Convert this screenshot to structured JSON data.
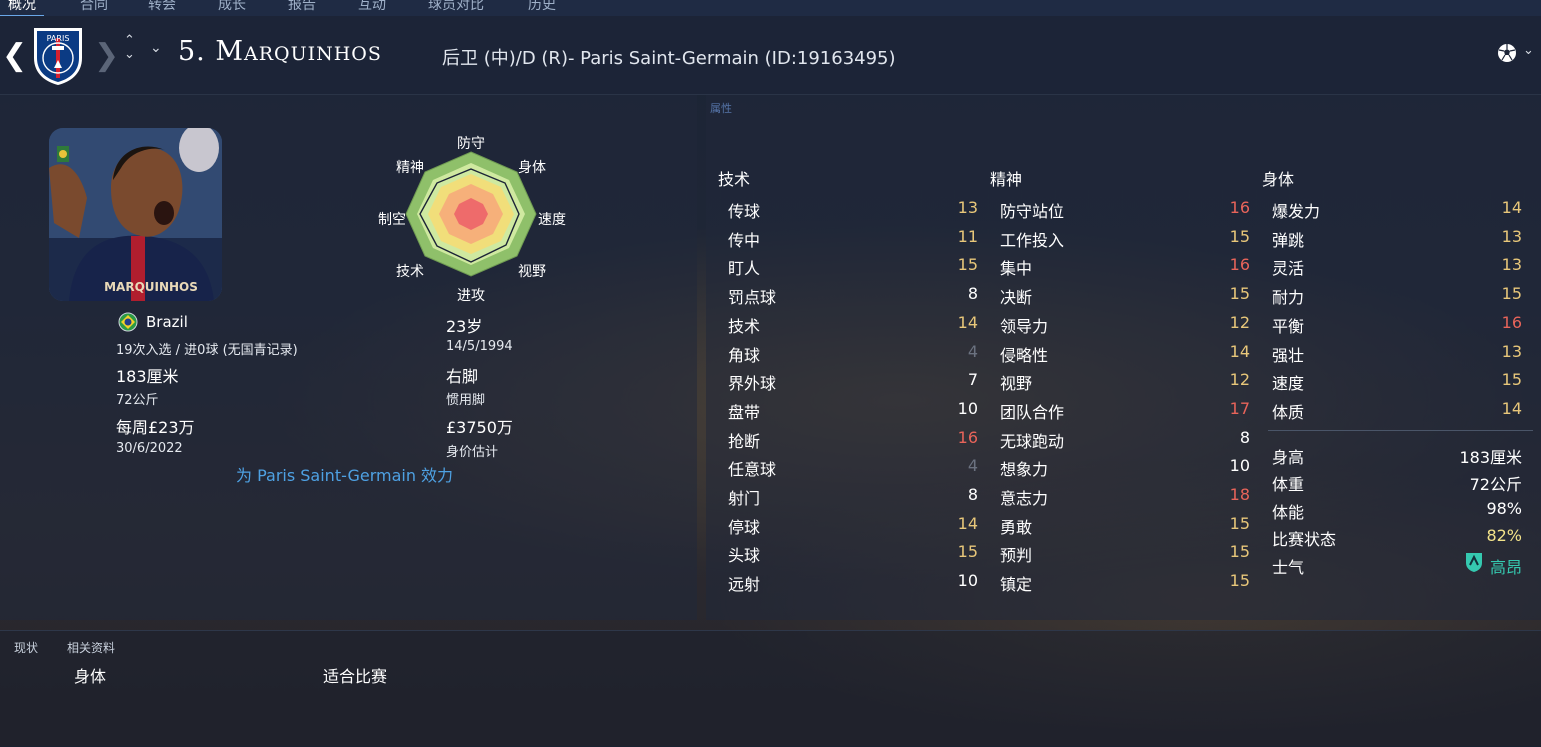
{
  "colors": {
    "attr_high": "#e8645a",
    "attr_good": "#e8c77a",
    "attr_normal": "#ffffff",
    "attr_low": "#6b7280",
    "link": "#4ea1e3",
    "morale": "#35c9b0"
  },
  "topbar": {
    "tabs": [
      "概况",
      "合同",
      "转会",
      "成长",
      "报告",
      "互动",
      "球员对比",
      "历史"
    ]
  },
  "header": {
    "name": "5. Marquinhos",
    "subtitle": "后卫 (中)/D (R)- Paris Saint-Germain (ID:19163495)",
    "crest_text": "PARIS"
  },
  "panel": {
    "title": "属性"
  },
  "profile": {
    "photo_name": "MARQUINHOS",
    "nation": "Brazil",
    "caps": "19次入选 / 进0球 (无国青记录)",
    "height": "183厘米",
    "weight": "72公斤",
    "wage": "每周£23万",
    "contract_end": "30/6/2022",
    "age": "23岁",
    "dob": "14/5/1994",
    "foot": "右脚",
    "foot_label": "惯用脚",
    "value": "£3750万",
    "value_label": "身价估计",
    "plays_for": "为 Paris Saint-Germain 效力"
  },
  "radar": {
    "labels": [
      "防守",
      "身体",
      "速度",
      "视野",
      "进攻",
      "技术",
      "制空",
      "精神"
    ]
  },
  "attributes": {
    "technical_title": "技术",
    "mental_title": "精神",
    "physical_title": "身体",
    "technical": [
      {
        "name": "传球",
        "value": "13",
        "tier": "good"
      },
      {
        "name": "传中",
        "value": "11",
        "tier": "good"
      },
      {
        "name": "盯人",
        "value": "15",
        "tier": "good"
      },
      {
        "name": "罚点球",
        "value": "8",
        "tier": "normal"
      },
      {
        "name": "技术",
        "value": "14",
        "tier": "good"
      },
      {
        "name": "角球",
        "value": "4",
        "tier": "low"
      },
      {
        "name": "界外球",
        "value": "7",
        "tier": "normal"
      },
      {
        "name": "盘带",
        "value": "10",
        "tier": "normal"
      },
      {
        "name": "抢断",
        "value": "16",
        "tier": "high"
      },
      {
        "name": "任意球",
        "value": "4",
        "tier": "low"
      },
      {
        "name": "射门",
        "value": "8",
        "tier": "normal"
      },
      {
        "name": "停球",
        "value": "14",
        "tier": "good"
      },
      {
        "name": "头球",
        "value": "15",
        "tier": "good"
      },
      {
        "name": "远射",
        "value": "10",
        "tier": "normal"
      }
    ],
    "mental": [
      {
        "name": "防守站位",
        "value": "16",
        "tier": "high"
      },
      {
        "name": "工作投入",
        "value": "15",
        "tier": "good"
      },
      {
        "name": "集中",
        "value": "16",
        "tier": "high"
      },
      {
        "name": "决断",
        "value": "15",
        "tier": "good"
      },
      {
        "name": "领导力",
        "value": "12",
        "tier": "good"
      },
      {
        "name": "侵略性",
        "value": "14",
        "tier": "good"
      },
      {
        "name": "视野",
        "value": "12",
        "tier": "good"
      },
      {
        "name": "团队合作",
        "value": "17",
        "tier": "high"
      },
      {
        "name": "无球跑动",
        "value": "8",
        "tier": "normal"
      },
      {
        "name": "想象力",
        "value": "10",
        "tier": "normal"
      },
      {
        "name": "意志力",
        "value": "18",
        "tier": "high"
      },
      {
        "name": "勇敢",
        "value": "15",
        "tier": "good"
      },
      {
        "name": "预判",
        "value": "15",
        "tier": "good"
      },
      {
        "name": "镇定",
        "value": "15",
        "tier": "good"
      }
    ],
    "physical": [
      {
        "name": "爆发力",
        "value": "14",
        "tier": "good"
      },
      {
        "name": "弹跳",
        "value": "13",
        "tier": "good"
      },
      {
        "name": "灵活",
        "value": "13",
        "tier": "good"
      },
      {
        "name": "耐力",
        "value": "15",
        "tier": "good"
      },
      {
        "name": "平衡",
        "value": "16",
        "tier": "high"
      },
      {
        "name": "强壮",
        "value": "13",
        "tier": "good"
      },
      {
        "name": "速度",
        "value": "15",
        "tier": "good"
      },
      {
        "name": "体质",
        "value": "14",
        "tier": "good"
      }
    ]
  },
  "physical_info": {
    "height_label": "身高",
    "height_value": "183厘米",
    "weight_label": "体重",
    "weight_value": "72公斤",
    "condition_label": "体能",
    "condition_value": "98%",
    "sharpness_label": "比赛状态",
    "sharpness_value": "82%",
    "morale_label": "士气",
    "morale_value": "高昂"
  },
  "bottom": {
    "tabs": [
      "现状",
      "相关资料"
    ],
    "item_left": "身体",
    "item_right": "适合比赛"
  }
}
